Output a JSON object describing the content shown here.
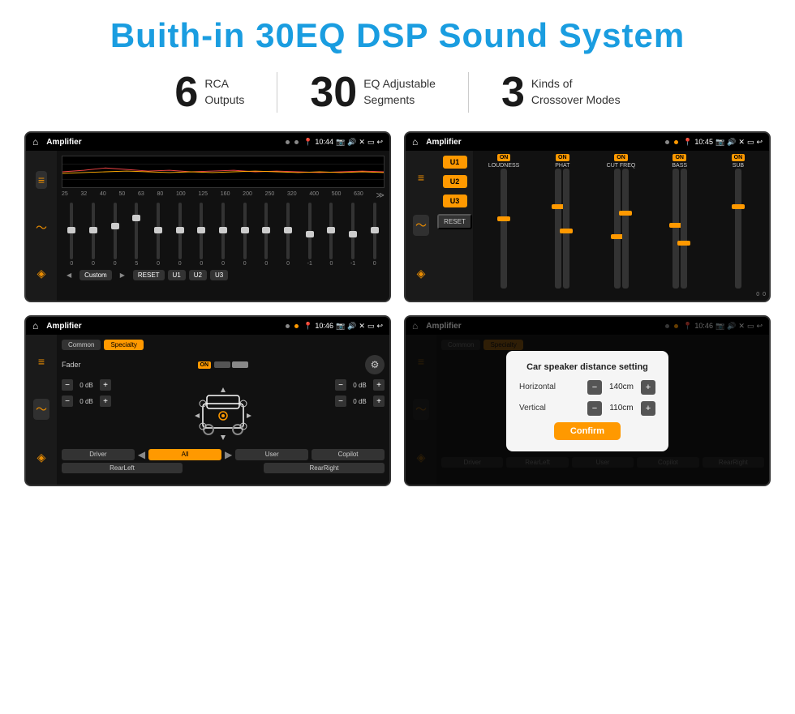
{
  "header": {
    "title": "Buith-in 30EQ DSP Sound System"
  },
  "stats": [
    {
      "number": "6",
      "label": "RCA\nOutputs"
    },
    {
      "number": "30",
      "label": "EQ Adjustable\nSegments"
    },
    {
      "number": "3",
      "label": "Kinds of\nCrossover Modes"
    }
  ],
  "screens": [
    {
      "id": "eq-screen",
      "statusBar": {
        "appTitle": "Amplifier",
        "time": "10:44"
      }
    },
    {
      "id": "crossover-screen",
      "statusBar": {
        "appTitle": "Amplifier",
        "time": "10:45"
      }
    },
    {
      "id": "fader-screen",
      "statusBar": {
        "appTitle": "Amplifier",
        "time": "10:46"
      }
    },
    {
      "id": "dialog-screen",
      "statusBar": {
        "appTitle": "Amplifier",
        "time": "10:46"
      },
      "dialog": {
        "title": "Car speaker distance setting",
        "horizontal_label": "Horizontal",
        "horizontal_value": "140cm",
        "vertical_label": "Vertical",
        "vertical_value": "110cm",
        "confirm_label": "Confirm"
      }
    }
  ],
  "eq": {
    "frequencies": [
      "25",
      "32",
      "40",
      "50",
      "63",
      "80",
      "100",
      "125",
      "160",
      "200",
      "250",
      "320",
      "400",
      "500",
      "630"
    ],
    "values": [
      "0",
      "0",
      "0",
      "5",
      "0",
      "0",
      "0",
      "0",
      "0",
      "0",
      "0",
      "-1",
      "0",
      "-1",
      "0"
    ],
    "presets": [
      "Custom",
      "RESET",
      "U1",
      "U2",
      "U3"
    ]
  },
  "crossover": {
    "units": [
      "U1",
      "U2",
      "U3"
    ],
    "channels": [
      "LOUDNESS",
      "PHAT",
      "CUT FREQ",
      "BASS",
      "SUB"
    ],
    "reset_label": "RESET"
  },
  "fader": {
    "tabs": [
      "Common",
      "Specialty"
    ],
    "fader_label": "Fader",
    "on_label": "ON",
    "db_rows": [
      {
        "value": "0 dB"
      },
      {
        "value": "0 dB"
      },
      {
        "value": "0 dB"
      },
      {
        "value": "0 dB"
      }
    ],
    "bottom_buttons": [
      "Driver",
      "All",
      "User",
      "Copilot",
      "RearLeft",
      "RearRight"
    ]
  }
}
